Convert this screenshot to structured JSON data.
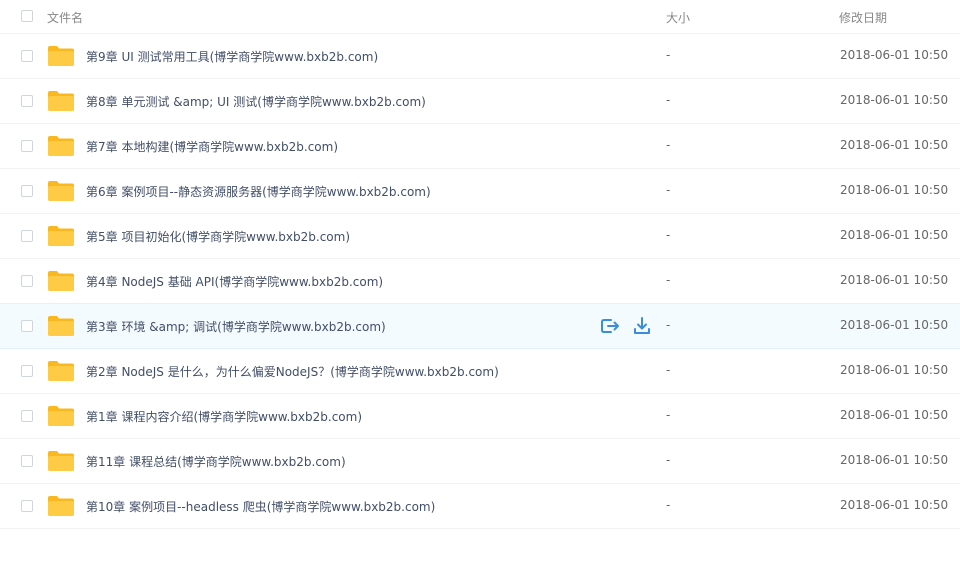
{
  "header": {
    "name_label": "文件名",
    "size_label": "大小",
    "date_label": "修改日期"
  },
  "colors": {
    "folder": "#ffcb45",
    "folder_back": "#f9b81f",
    "action": "#3b8cd9",
    "hover_bg": "#f4fbff"
  },
  "files": [
    {
      "name": "第9章 UI 测试常用工具(博学商学院www.bxb2b.com)",
      "size": "-",
      "date": "2018-06-01 10:50"
    },
    {
      "name": "第8章 单元测试 &amp; UI 测试(博学商学院www.bxb2b.com)",
      "size": "-",
      "date": "2018-06-01 10:50"
    },
    {
      "name": "第7章 本地构建(博学商学院www.bxb2b.com)",
      "size": "-",
      "date": "2018-06-01 10:50"
    },
    {
      "name": "第6章 案例项目--静态资源服务器(博学商学院www.bxb2b.com)",
      "size": "-",
      "date": "2018-06-01 10:50"
    },
    {
      "name": "第5章 项目初始化(博学商学院www.bxb2b.com)",
      "size": "-",
      "date": "2018-06-01 10:50"
    },
    {
      "name": "第4章 NodeJS 基础 API(博学商学院www.bxb2b.com)",
      "size": "-",
      "date": "2018-06-01 10:50"
    },
    {
      "name": "第3章 环境 &amp; 调试(博学商学院www.bxb2b.com)",
      "size": "-",
      "date": "2018-06-01 10:50"
    },
    {
      "name": "第2章 NodeJS 是什么，为什么偏爱NodeJS？(博学商学院www.bxb2b.com)",
      "size": "-",
      "date": "2018-06-01 10:50"
    },
    {
      "name": "第1章 课程内容介绍(博学商学院www.bxb2b.com)",
      "size": "-",
      "date": "2018-06-01 10:50"
    },
    {
      "name": "第11章 课程总结(博学商学院www.bxb2b.com)",
      "size": "-",
      "date": "2018-06-01 10:50"
    },
    {
      "name": "第10章 案例项目--headless 爬虫(博学商学院www.bxb2b.com)",
      "size": "-",
      "date": "2018-06-01 10:50"
    }
  ]
}
